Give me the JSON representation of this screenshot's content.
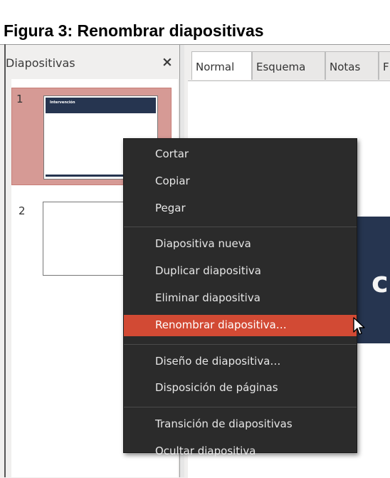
{
  "caption": "Figura 3: Renombrar diapositivas",
  "slides_pane": {
    "title": "Diapositivas",
    "close_glyph": "×",
    "slides": [
      {
        "number": "1",
        "thumb_title": "Intervención"
      },
      {
        "number": "2"
      }
    ]
  },
  "tabs": [
    {
      "label": "Normal",
      "active": true
    },
    {
      "label": "Esquema"
    },
    {
      "label": "Notas"
    },
    {
      "label": "F"
    }
  ],
  "slide_title_fragment": "ció",
  "context_menu": {
    "groups": [
      [
        "Cortar",
        "Copiar",
        "Pegar"
      ],
      [
        "Diapositiva nueva",
        "Duplicar diapositiva",
        "Eliminar diapositiva",
        "Renombrar diapositiva…"
      ],
      [
        "Diseño de diapositiva…",
        "Disposición de páginas"
      ],
      [
        "Transición de diapositivas",
        "Ocultar diapositiva"
      ]
    ],
    "highlighted": "Renombrar diapositiva…"
  },
  "colors": {
    "menu_bg": "#2b2b2b",
    "menu_highlight": "#d24a34",
    "selected_slide_bg": "#d69a95",
    "slide_theme": "#263550"
  }
}
